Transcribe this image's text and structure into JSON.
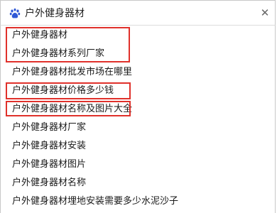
{
  "search": {
    "query": "户外健身器材",
    "logo_icon": "baidu-paw-icon",
    "clear_icon": "close-icon"
  },
  "suggestions": [
    "户外健身器材",
    "户外健身器材系列厂家",
    "户外健身器材批发市场在哪里",
    "户外健身器材价格多少钱",
    "户外健身器材名称及图片大全",
    "户外健身器材厂家",
    "户外健身器材安装",
    "户外健身器材图片",
    "户外健身器材名称",
    "户外健身器材埋地安装需要多少水泥沙子"
  ],
  "colors": {
    "highlight_border": "#e0312b",
    "logo": "#2f58d6"
  }
}
